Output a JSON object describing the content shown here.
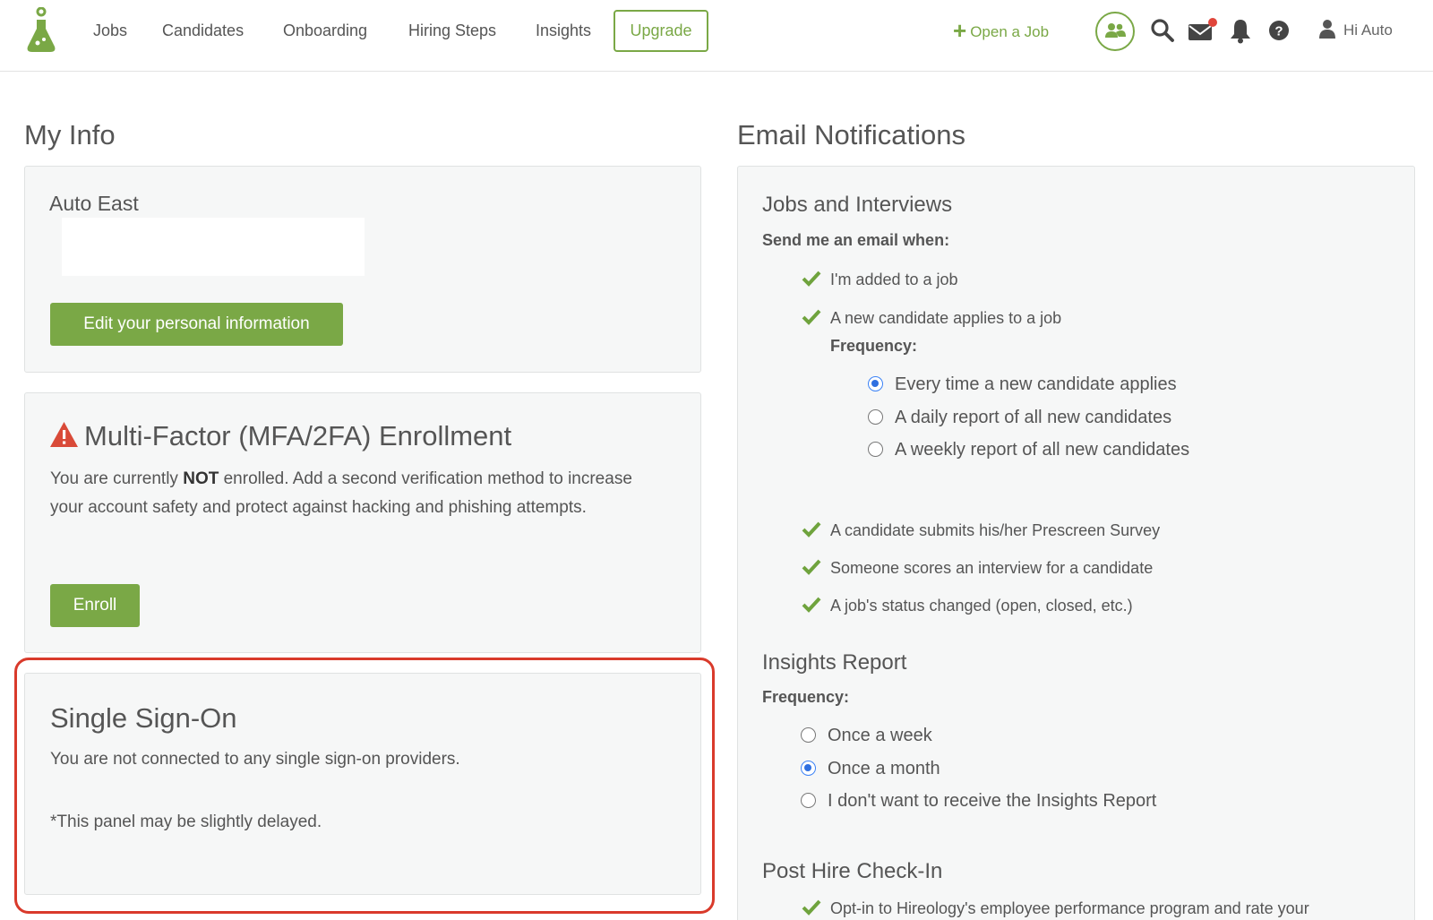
{
  "nav": {
    "links": [
      "Jobs",
      "Candidates",
      "Onboarding",
      "Hiring Steps",
      "Insights"
    ],
    "upgrade": "Upgrade",
    "open_job": "Open a Job",
    "greeting": "Hi Auto",
    "brand_color": "#7aa846",
    "notification_dot_color": "#e0453a"
  },
  "my_info": {
    "heading": "My Info",
    "name": "Auto East",
    "edit_button": "Edit your personal information"
  },
  "mfa": {
    "title": "Multi-Factor (MFA/2FA) Enrollment",
    "text_before": "You are currently ",
    "text_bold": "NOT",
    "text_after": " enrolled. Add a second verification method to increase your account safety and protect against hacking and phishing attempts.",
    "enroll_button": "Enroll",
    "warning_color": "#d94a38"
  },
  "sso": {
    "title": "Single Sign-On",
    "status": "You are not connected to any single sign-on providers.",
    "note": "*This panel may be slightly delayed.",
    "highlight_color": "#d93a2b"
  },
  "email": {
    "heading": "Email Notifications",
    "jobs": {
      "title": "Jobs and Interviews",
      "send_label": "Send me an email when:",
      "items": [
        "I'm added to a job",
        "A new candidate applies to a job",
        "A candidate submits his/her Prescreen Survey",
        "Someone scores an interview for a candidate",
        "A job's status changed (open, closed, etc.)"
      ],
      "frequency_label": "Frequency:",
      "frequency_options": [
        "Every time a new candidate applies",
        "A daily report of all new candidates",
        "A weekly report of all new candidates"
      ],
      "frequency_selected": "Every time a new candidate applies"
    },
    "insights": {
      "title": "Insights Report",
      "frequency_label": "Frequency:",
      "options": [
        "Once a week",
        "Once a month",
        "I don't want to receive the Insights Report"
      ],
      "selected": "Once a month"
    },
    "post_hire": {
      "title": "Post Hire Check-In",
      "item": "Opt-in to Hireology's employee performance program and rate your"
    }
  }
}
